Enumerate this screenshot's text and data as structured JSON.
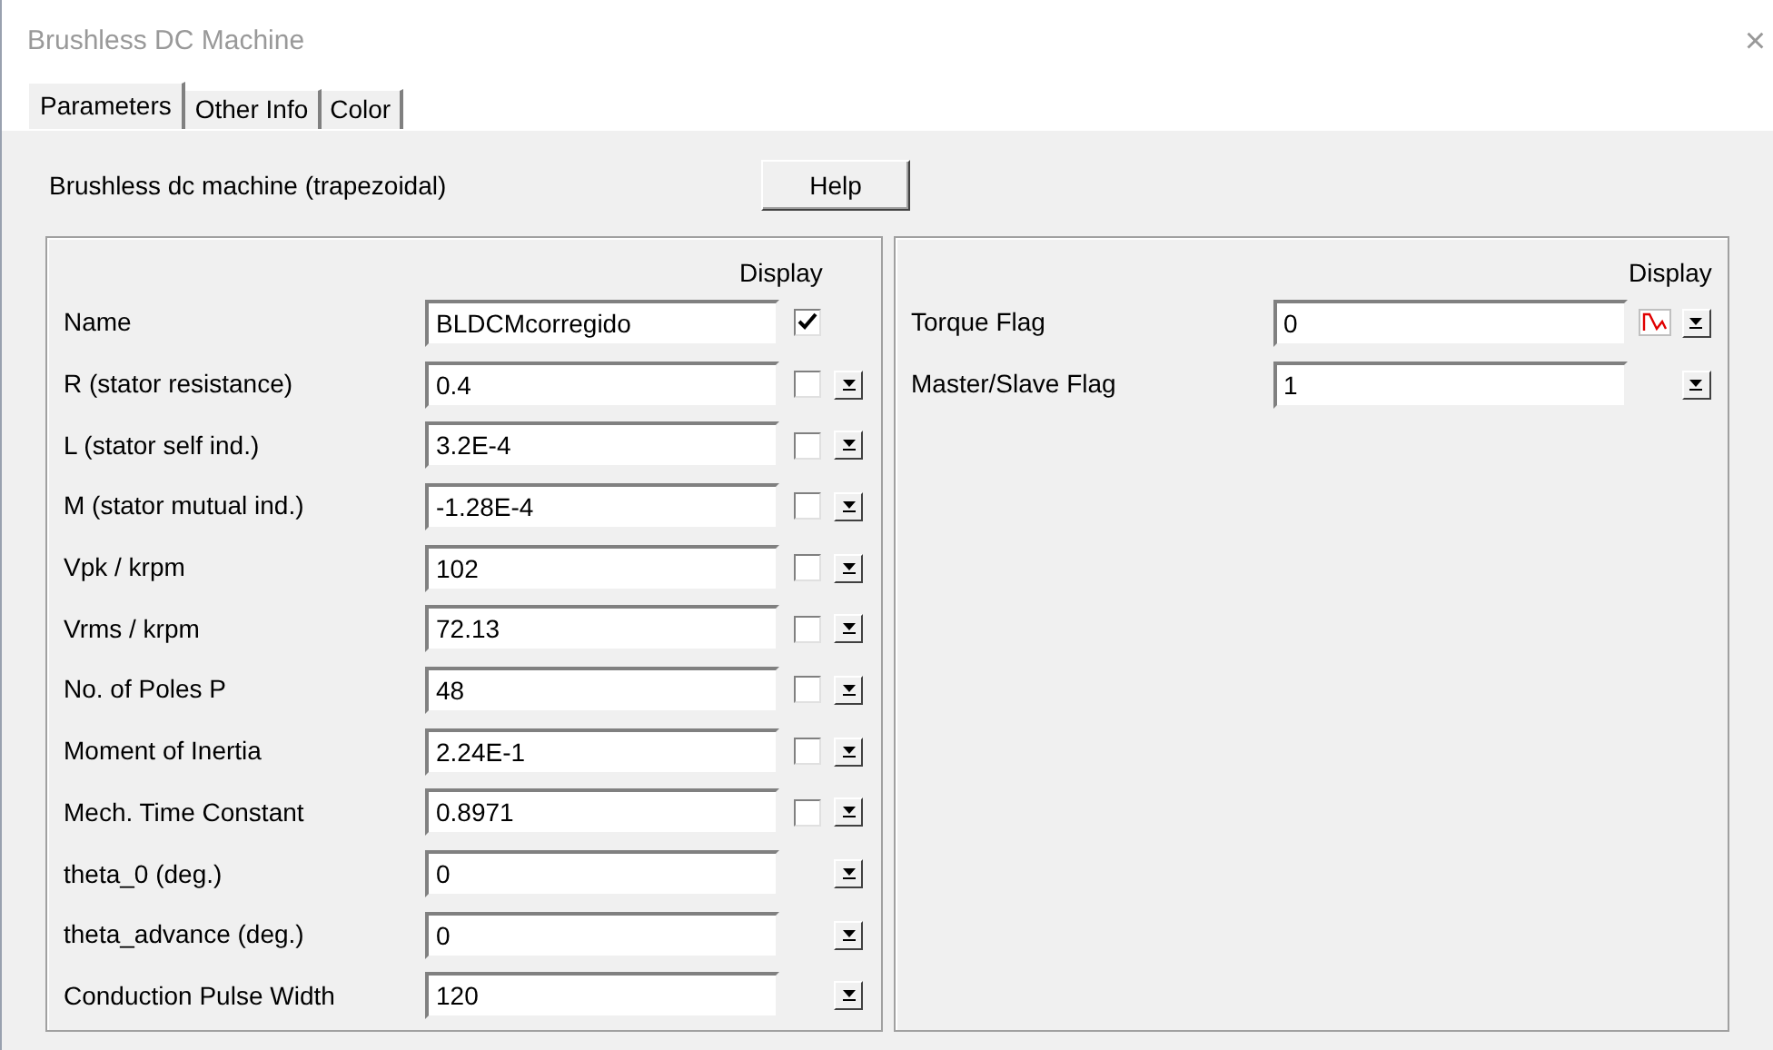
{
  "window": {
    "title": "Brushless DC Machine",
    "close": "×"
  },
  "tabs": [
    {
      "label": "Parameters",
      "selected": true
    },
    {
      "label": "Other Info",
      "selected": false
    },
    {
      "label": "Color",
      "selected": false
    }
  ],
  "description": "Brushless dc machine (trapezoidal)",
  "help_button": "Help",
  "left_panel": {
    "display_header": "Display",
    "rows": [
      {
        "label": "Name",
        "value": "BLDCMcorregido",
        "kind": "checkbox",
        "checked": true,
        "dropdown": false
      },
      {
        "label": "R (stator resistance)",
        "value": "0.4",
        "kind": "checkbox",
        "checked": false,
        "dropdown": true
      },
      {
        "label": "L (stator self ind.)",
        "value": "3.2E-4",
        "kind": "checkbox",
        "checked": false,
        "dropdown": true
      },
      {
        "label": "M (stator mutual ind.)",
        "value": "-1.28E-4",
        "kind": "checkbox",
        "checked": false,
        "dropdown": true
      },
      {
        "label": "Vpk / krpm",
        "value": "102",
        "kind": "checkbox",
        "checked": false,
        "dropdown": true
      },
      {
        "label": "Vrms / krpm",
        "value": "72.13",
        "kind": "checkbox",
        "checked": false,
        "dropdown": true
      },
      {
        "label": "No. of Poles P",
        "value": "48",
        "kind": "checkbox",
        "checked": false,
        "dropdown": true
      },
      {
        "label": "Moment of Inertia",
        "value": "2.24E-1",
        "kind": "checkbox",
        "checked": false,
        "dropdown": true
      },
      {
        "label": "Mech. Time Constant",
        "value": "0.8971",
        "kind": "checkbox",
        "checked": false,
        "dropdown": true
      },
      {
        "label": "theta_0 (deg.)",
        "value": "0",
        "kind": "plain",
        "dropdown": true
      },
      {
        "label": "theta_advance (deg.)",
        "value": "0",
        "kind": "plain",
        "dropdown": true
      },
      {
        "label": "Conduction Pulse Width",
        "value": "120",
        "kind": "plain",
        "dropdown": true
      }
    ]
  },
  "right_panel": {
    "display_header": "Display",
    "rows": [
      {
        "label": "Torque Flag",
        "value": "0",
        "kind": "graph",
        "dropdown": true
      },
      {
        "label": "Master/Slave Flag",
        "value": "1",
        "kind": "plain",
        "dropdown": true
      }
    ]
  }
}
